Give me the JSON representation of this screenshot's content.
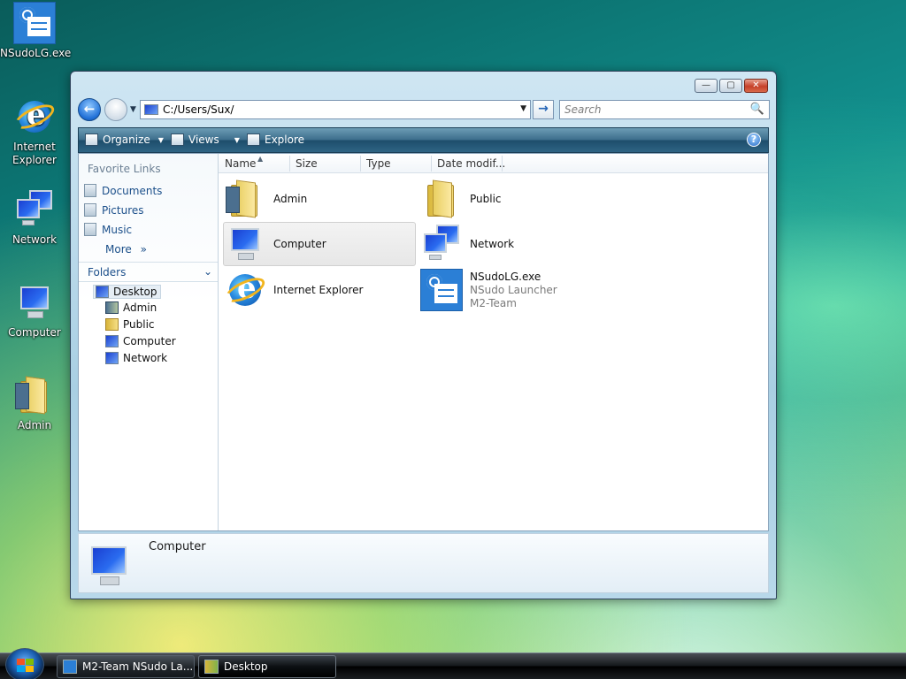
{
  "desktop": {
    "icons": [
      {
        "label": "NSudoLG.exe",
        "icon": "nsudo-app-icon"
      },
      {
        "label": "Internet Explorer",
        "icon": "internet-explorer-icon"
      },
      {
        "label": "Network",
        "icon": "network-icon"
      },
      {
        "label": "Computer",
        "icon": "computer-icon"
      },
      {
        "label": "Admin",
        "icon": "user-folder-icon"
      }
    ]
  },
  "window": {
    "controls": {
      "minimize": "—",
      "maximize": "▢",
      "close": "✕"
    },
    "address": {
      "path": "C:/Users/Sux/",
      "dropdown": "▼",
      "go": "→"
    },
    "search": {
      "placeholder": "Search",
      "icon": "🔍"
    },
    "nav": {
      "back": "←",
      "dropdown": "▼"
    },
    "toolbar": {
      "organize": "Organize",
      "views": "Views",
      "explore": "Explore",
      "help": "?"
    },
    "nav_pane": {
      "favorites_title": "Favorite Links",
      "favorites": [
        "Documents",
        "Pictures",
        "Music"
      ],
      "more": "More",
      "more_chevron": "»",
      "folders_label": "Folders",
      "folders_chevron": "⌄",
      "tree": [
        {
          "label": "Desktop",
          "icon": "desktop-icon"
        },
        {
          "label": "Admin",
          "icon": "user-folder-icon"
        },
        {
          "label": "Public",
          "icon": "folder-icon"
        },
        {
          "label": "Computer",
          "icon": "computer-icon"
        },
        {
          "label": "Network",
          "icon": "network-icon"
        }
      ]
    },
    "columns": [
      "Name",
      "Size",
      "Type",
      "Date modif..."
    ],
    "items": [
      {
        "name": "Admin",
        "icon": "user-folder-icon"
      },
      {
        "name": "Public",
        "icon": "folder-icon"
      },
      {
        "name": "Computer",
        "icon": "computer-icon",
        "selected": true
      },
      {
        "name": "Network",
        "icon": "network-icon"
      },
      {
        "name": "Internet Explorer",
        "icon": "internet-explorer-icon"
      },
      {
        "name": "NSudoLG.exe",
        "line2": "NSudo Launcher",
        "line3": "M2-Team",
        "icon": "nsudo-app-icon"
      }
    ],
    "details": {
      "name": "Computer"
    }
  },
  "taskbar": {
    "buttons": [
      {
        "label": "M2-Team NSudo La...",
        "icon": "nsudo-app-icon"
      },
      {
        "label": "Desktop",
        "icon": "desktop-folder-icon",
        "active": true
      }
    ]
  }
}
